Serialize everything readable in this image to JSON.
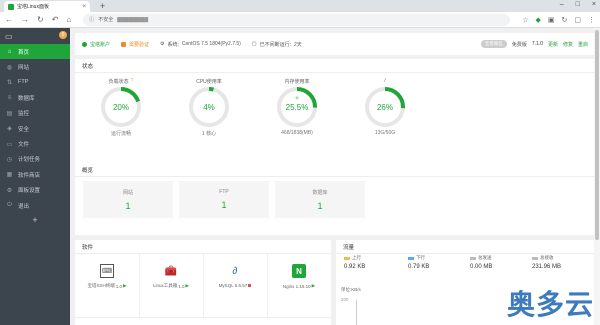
{
  "browser": {
    "tab_title": "宝塔Linux面板",
    "security_label": "不安全",
    "address": "▇▇▇▇▇▇▇▇"
  },
  "sidebar": {
    "badge": "0",
    "items": [
      {
        "label": "首页",
        "icon": "home-icon",
        "glyph": "⌂",
        "active": true
      },
      {
        "label": "网站",
        "icon": "globe-icon",
        "glyph": "◍"
      },
      {
        "label": "FTP",
        "icon": "ftp-icon",
        "glyph": "⇅"
      },
      {
        "label": "数据库",
        "icon": "database-icon",
        "glyph": "≡"
      },
      {
        "label": "监控",
        "icon": "monitor-icon",
        "glyph": "▤"
      },
      {
        "label": "安全",
        "icon": "shield-icon",
        "glyph": "◈"
      },
      {
        "label": "文件",
        "icon": "folder-icon",
        "glyph": "▭"
      },
      {
        "label": "计划任务",
        "icon": "clock-icon",
        "glyph": "◷"
      },
      {
        "label": "软件商店",
        "icon": "store-icon",
        "glyph": "▦"
      },
      {
        "label": "面板设置",
        "icon": "gear-icon",
        "glyph": "⚙"
      },
      {
        "label": "退出",
        "icon": "logout-icon",
        "glyph": "⏻"
      }
    ],
    "add": "+"
  },
  "infobar": {
    "account": "宝塔账户",
    "account_state": "需要验证",
    "system_label": "系统:",
    "system_value": "CentOS 7.5 1804(Py2.7.5)",
    "uptime_label": "已不间断运行:",
    "uptime_value": "2天",
    "wechat": "宝塔微信",
    "version_label": "免费版",
    "version": "7.1.0",
    "update": "更新",
    "repair": "修复",
    "restart": "重启"
  },
  "status": {
    "title": "状态",
    "gauges": [
      {
        "label": "负载状态",
        "percent": 20,
        "value": "20%",
        "sub": "运行流畅",
        "info": "?"
      },
      {
        "label": "CPU使用率",
        "percent": 4,
        "value": "4%",
        "sub": "1 核心"
      },
      {
        "label": "内存使用率",
        "percent": 25.5,
        "value": "25.5%",
        "sub": "468/1838(MB)",
        "leaf": "✧"
      },
      {
        "label": "/",
        "percent": 26,
        "value": "26%",
        "sub": "13G/50G"
      }
    ]
  },
  "overview": {
    "title": "概览",
    "cards": [
      {
        "label": "网站",
        "value": "1"
      },
      {
        "label": "FTP",
        "value": "1"
      },
      {
        "label": "数据库",
        "value": "1"
      }
    ]
  },
  "software": {
    "title": "软件",
    "items": [
      {
        "label": "宝塔SSH终端",
        "version": "1.0",
        "icon": "terminal-icon",
        "glyph": "⌨",
        "state": "running"
      },
      {
        "label": "Linux工具箱",
        "version": "1.0",
        "icon": "toolbox-icon",
        "glyph": "🧰",
        "state": "running"
      },
      {
        "label": "MySQL 5.5.57",
        "version": "",
        "icon": "mysql-icon",
        "glyph": "∂",
        "state": "stopped"
      },
      {
        "label": "Nginx 1.15.10",
        "version": "",
        "icon": "nginx-icon",
        "glyph": "N",
        "state": "running"
      }
    ]
  },
  "traffic": {
    "title": "流量",
    "legend": [
      {
        "label": "上行",
        "value": "0.92 KB",
        "color": "#f7b851"
      },
      {
        "label": "下行",
        "value": "0.79 KB",
        "color": "#52a9ff"
      },
      {
        "label": "总发送",
        "value": "0.00 MB",
        "color": "#bbbbbb"
      },
      {
        "label": "总接收",
        "value": "231.96 MB",
        "color": "#bbbbbb"
      }
    ],
    "unit_label": "单位:KB/s",
    "y_top": "200"
  },
  "watermark": "奥多云",
  "colors": {
    "accent": "#20a53a",
    "sidebar": "#3c444d",
    "ring_bg": "#e6e6e6"
  }
}
